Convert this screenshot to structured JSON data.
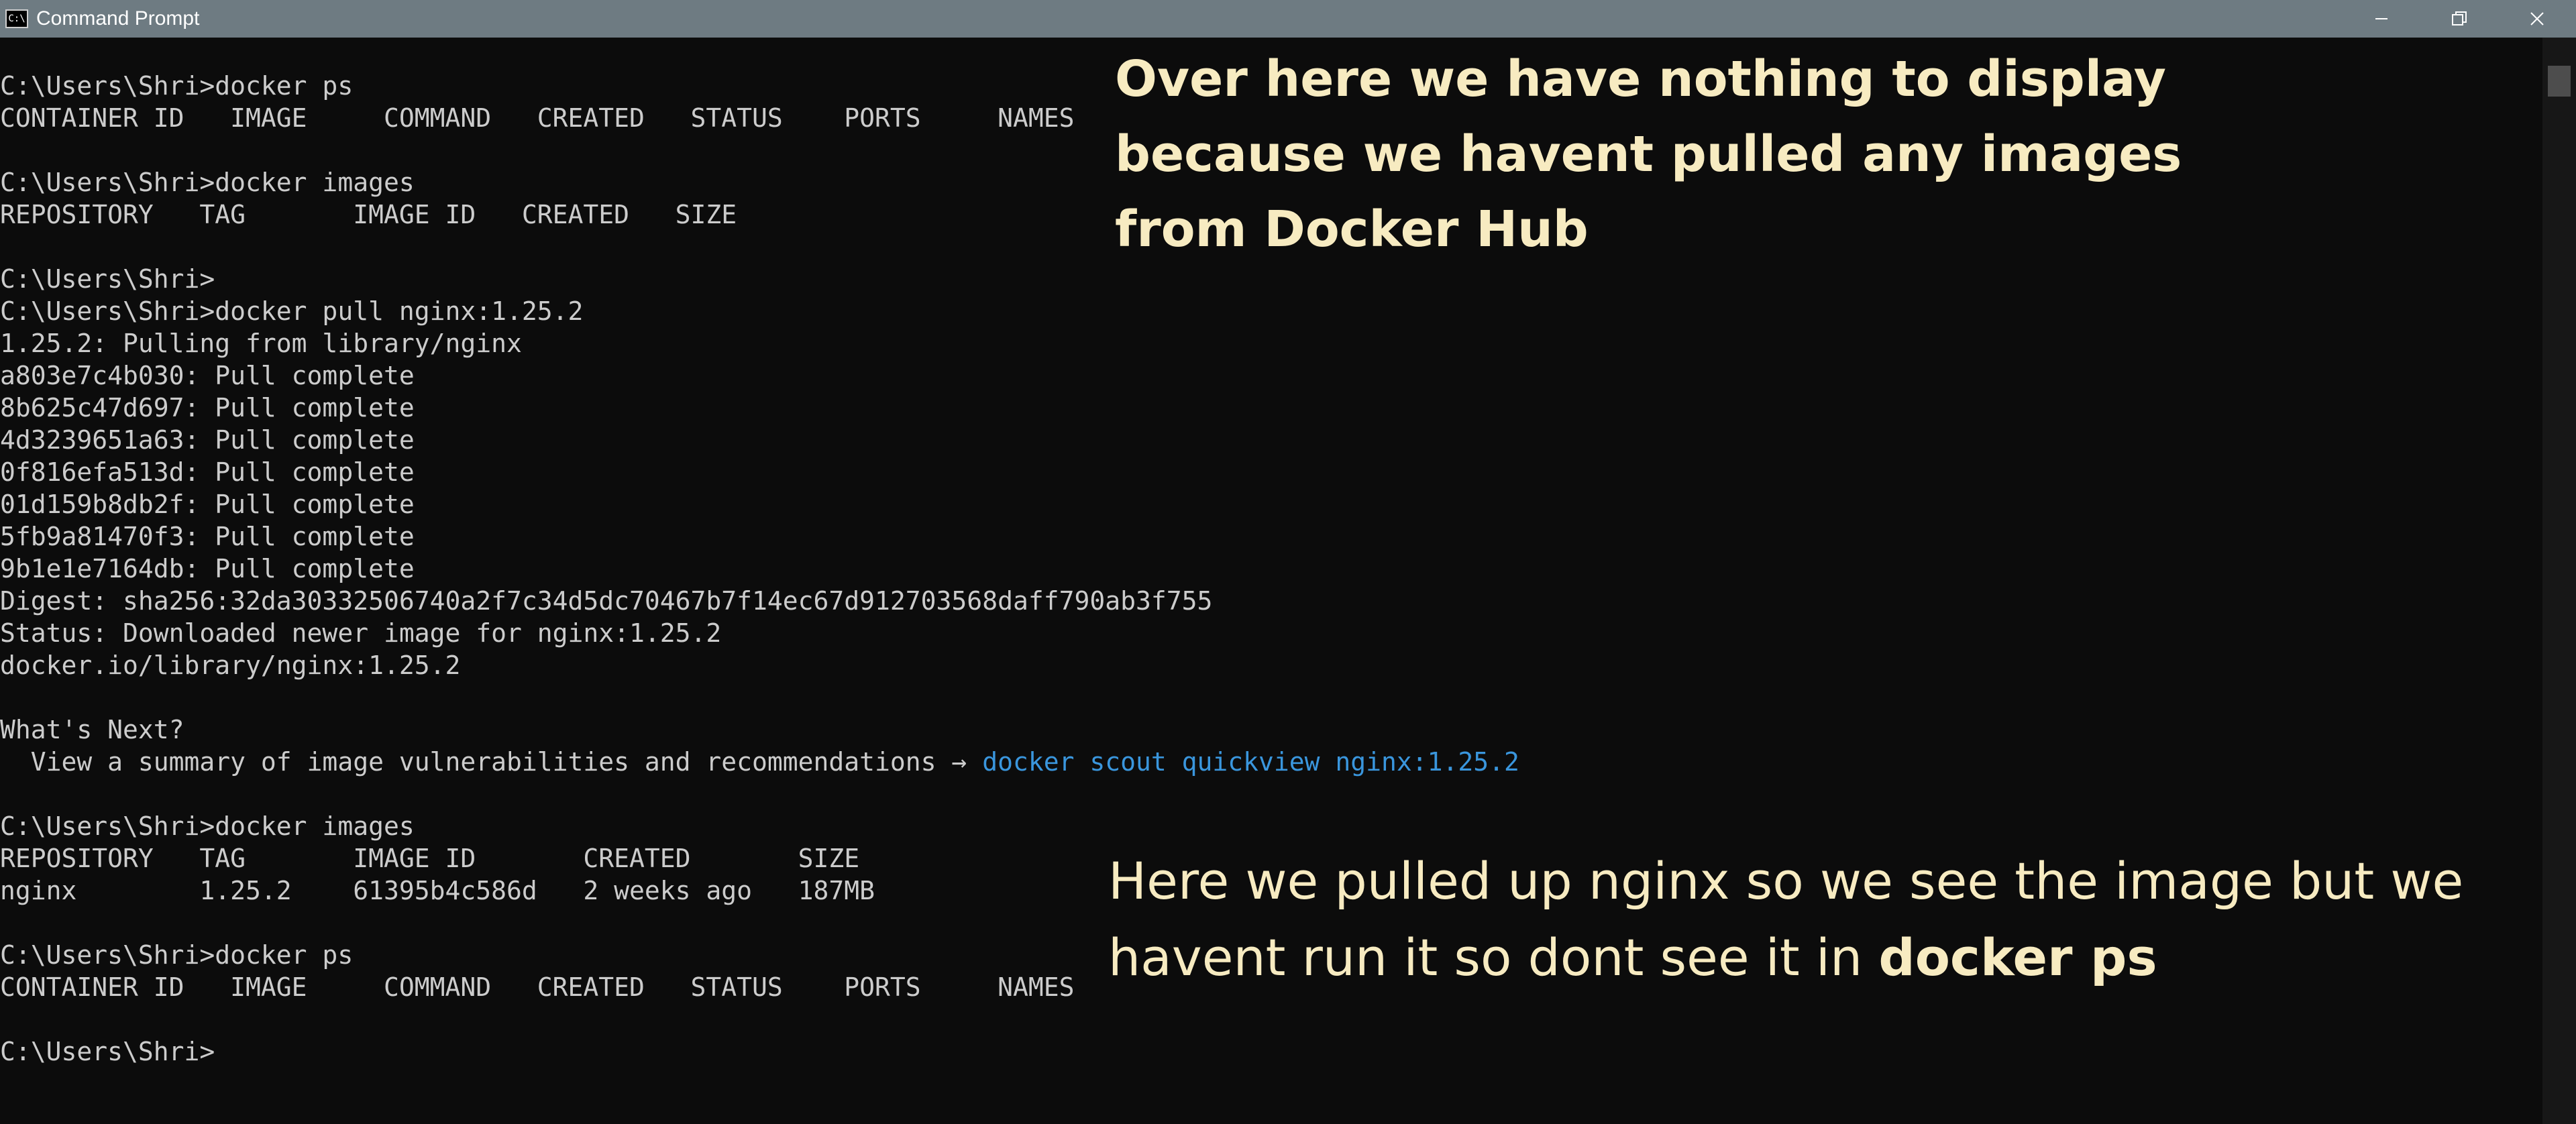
{
  "window": {
    "title": "Command Prompt",
    "app_icon_text": "C:\\"
  },
  "console": {
    "lines": [
      "",
      "C:\\Users\\Shri>docker ps",
      "CONTAINER ID   IMAGE     COMMAND   CREATED   STATUS    PORTS     NAMES",
      "",
      "C:\\Users\\Shri>docker images",
      "REPOSITORY   TAG       IMAGE ID   CREATED   SIZE",
      "",
      "C:\\Users\\Shri>",
      "C:\\Users\\Shri>docker pull nginx:1.25.2",
      "1.25.2: Pulling from library/nginx",
      "a803e7c4b030: Pull complete",
      "8b625c47d697: Pull complete",
      "4d3239651a63: Pull complete",
      "0f816efa513d: Pull complete",
      "01d159b8db2f: Pull complete",
      "5fb9a81470f3: Pull complete",
      "9b1e1e7164db: Pull complete",
      "Digest: sha256:32da30332506740a2f7c34d5dc70467b7f14ec67d912703568daff790ab3f755",
      "Status: Downloaded newer image for nginx:1.25.2",
      "docker.io/library/nginx:1.25.2",
      "",
      "What's Next?",
      "  View a summary of image vulnerabilities and recommendations → ",
      "",
      "C:\\Users\\Shri>docker images",
      "REPOSITORY   TAG       IMAGE ID       CREATED       SIZE",
      "nginx        1.25.2    61395b4c586d   2 weeks ago   187MB",
      "",
      "C:\\Users\\Shri>docker ps",
      "CONTAINER ID   IMAGE     COMMAND   CREATED   STATUS    PORTS     NAMES",
      "",
      "C:\\Users\\Shri>"
    ],
    "suggestion_command": "docker scout quickview nginx:1.25.2",
    "colors": {
      "background": "#0c0c0c",
      "text": "#cccccc",
      "link": "#3a96dd"
    }
  },
  "annotations": {
    "top": "Over here we have nothing to display because we havent pulled any images from Docker Hub",
    "bottom_text": "Here we pulled up nginx so we see the image but we havent run it so dont see it in ",
    "bottom_bold": "docker ps",
    "color": "#f7ebc1"
  }
}
